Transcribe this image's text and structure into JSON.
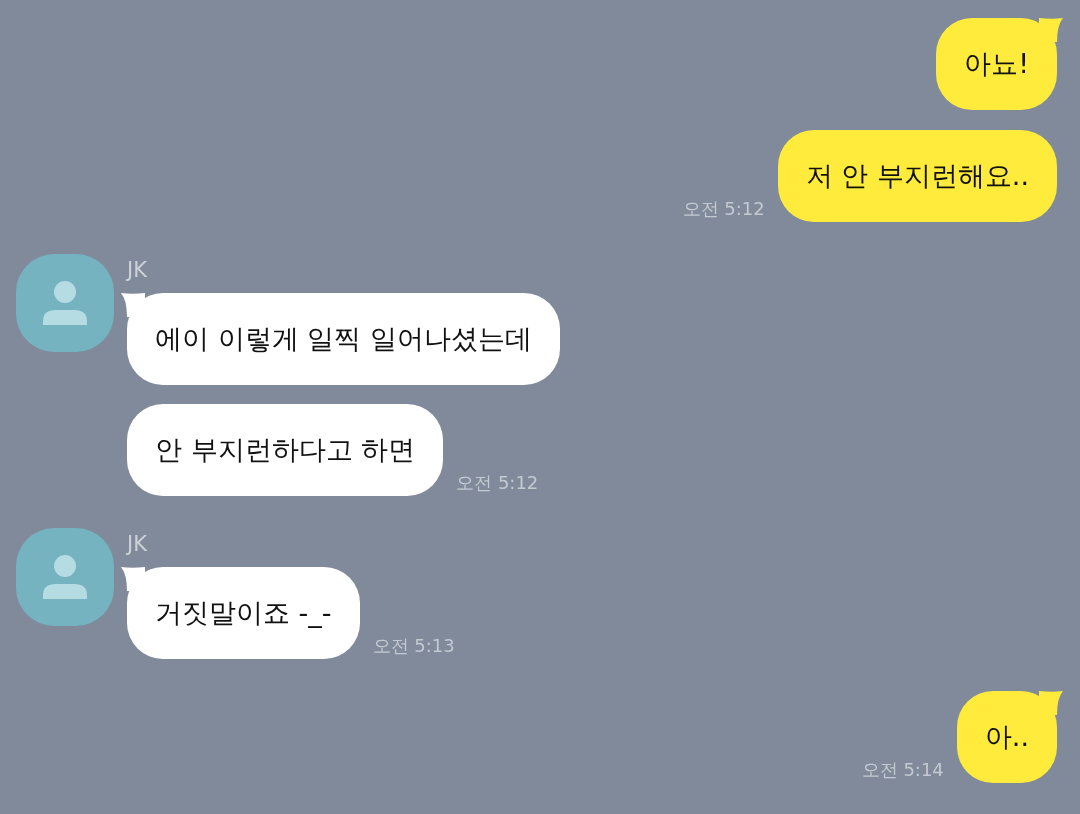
{
  "messages": [
    {
      "kind": "sent",
      "bubbles": [
        "아뇨!",
        "저 안 부지런해요.."
      ],
      "time": "오전 5:12"
    },
    {
      "kind": "received",
      "sender": "JK",
      "bubbles": [
        "에이 이렇게 일찍 일어나셨는데",
        "안 부지런하다고 하면"
      ],
      "time": "오전 5:12"
    },
    {
      "kind": "received",
      "sender": "JK",
      "bubbles": [
        "거짓말이죠 -_-"
      ],
      "time": "오전 5:13"
    },
    {
      "kind": "sent",
      "bubbles": [
        "아.."
      ],
      "time": "오전 5:14"
    }
  ]
}
